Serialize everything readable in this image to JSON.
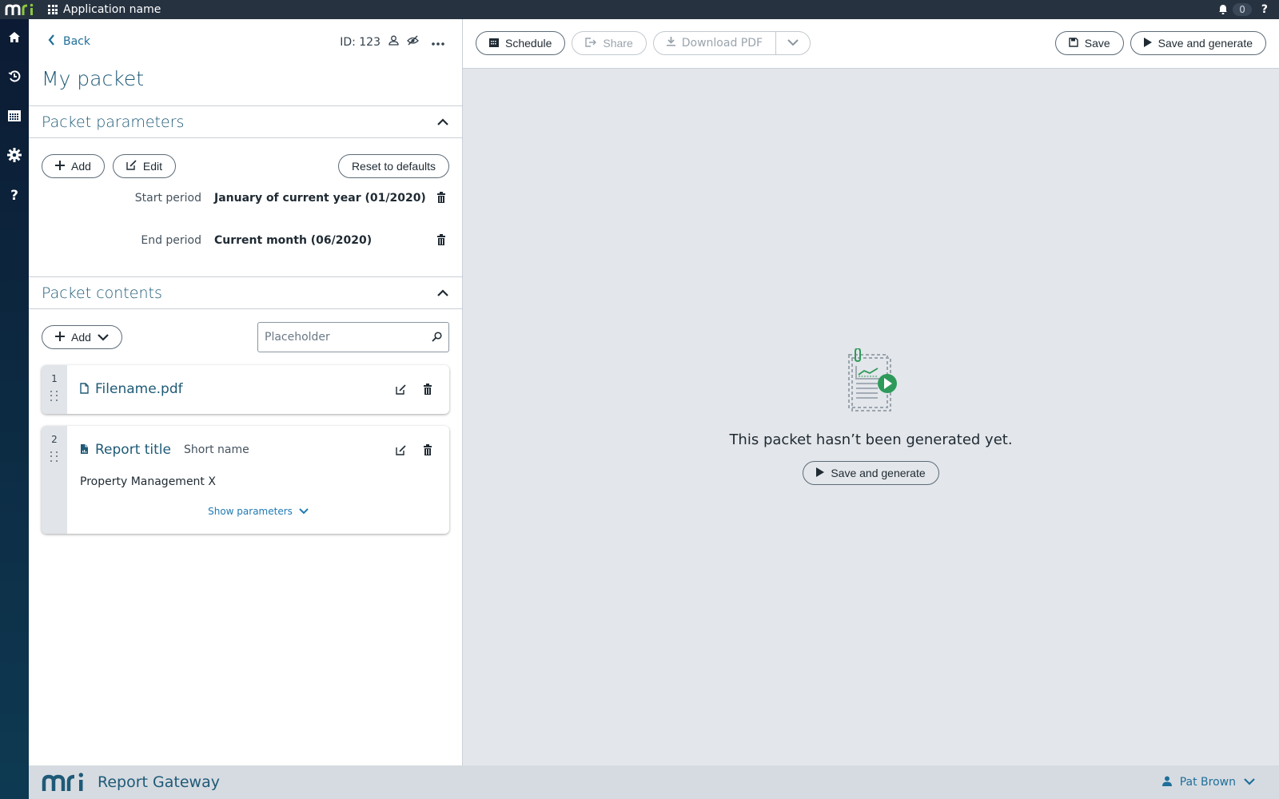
{
  "topbar": {
    "app_name": "Application name",
    "notification_count": "0",
    "help_label": "?"
  },
  "sidenav": {
    "items": [
      {
        "name": "home",
        "icon": "home-icon"
      },
      {
        "name": "history",
        "icon": "history-icon"
      },
      {
        "name": "calendar",
        "icon": "calendar-icon"
      },
      {
        "name": "settings",
        "icon": "gear-icon"
      },
      {
        "name": "help",
        "icon": "help-icon",
        "label": "?"
      }
    ]
  },
  "header": {
    "back_label": "Back",
    "id_label": "ID: 123",
    "title": "My packet"
  },
  "packet_parameters": {
    "heading": "Packet parameters",
    "add_label": "Add",
    "edit_label": "Edit",
    "reset_label": "Reset to defaults",
    "params": [
      {
        "key": "Start period",
        "value": "January of current year (01/2020)"
      },
      {
        "key": "End period",
        "value": "Current month (06/2020)"
      }
    ]
  },
  "packet_contents": {
    "heading": "Packet contents",
    "add_label": "Add",
    "search_placeholder": "Placeholder",
    "search_value": "",
    "items": [
      {
        "index": "1",
        "type": "file",
        "name": "Filename.pdf"
      },
      {
        "index": "2",
        "type": "report",
        "name": "Report title",
        "short_name": "Short name",
        "property": "Property Management X",
        "show_params_label": "Show parameters"
      }
    ]
  },
  "toolbar": {
    "schedule_label": "Schedule",
    "share_label": "Share",
    "download_label": "Download PDF",
    "save_label": "Save",
    "save_generate_label": "Save and generate"
  },
  "preview": {
    "empty_message": "This packet hasn’t been generated yet.",
    "save_generate_label": "Save and generate"
  },
  "footer": {
    "product_name": "Report Gateway",
    "user_name": "Pat Brown"
  },
  "colors": {
    "brand_green": "#8cc63f",
    "accent_blue": "#1e5a77",
    "link_blue": "#1f6f9a",
    "illustration_green": "#2e9a5a"
  }
}
